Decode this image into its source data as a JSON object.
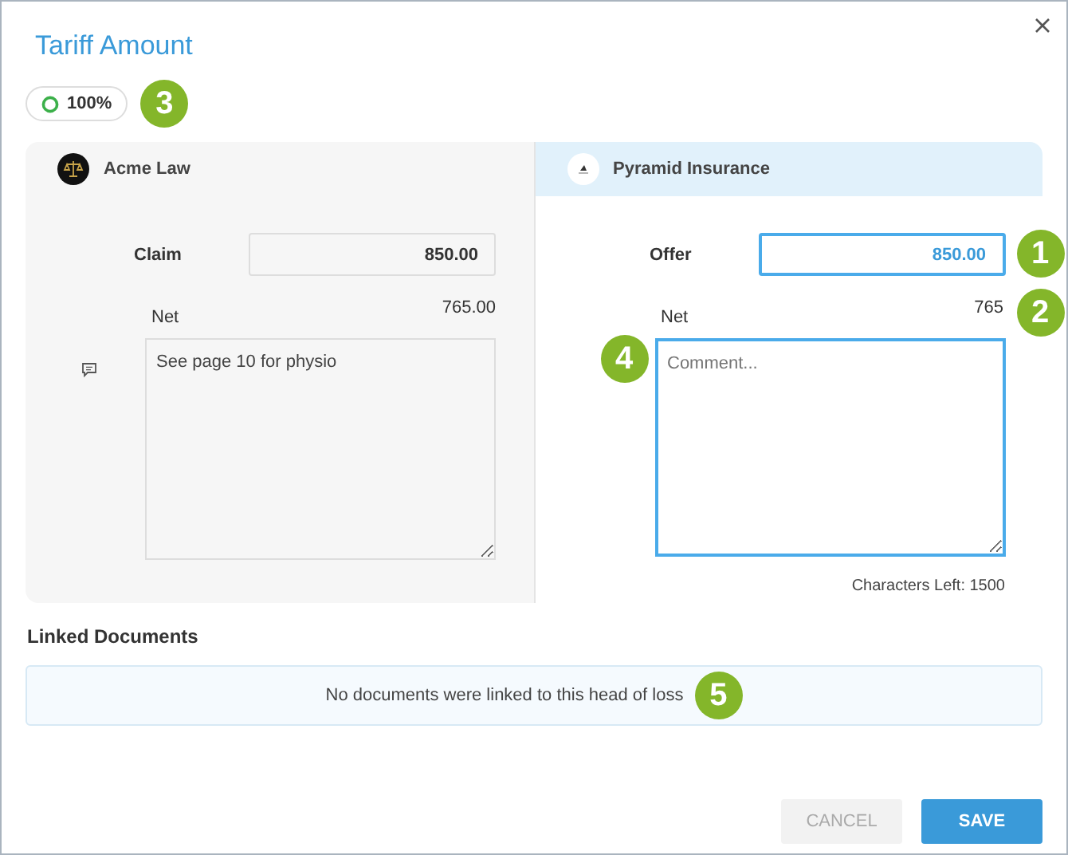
{
  "dialog": {
    "title": "Tariff Amount"
  },
  "progress_badge": {
    "label": "100%",
    "callout": "3"
  },
  "parties": [
    {
      "kind": "claimant",
      "selected": false,
      "name": "Acme Law",
      "amount_label": "Claim",
      "amount": "850.00",
      "net_label": "Net",
      "net": "765.00",
      "comment": "See page 10 for physio"
    },
    {
      "kind": "insurer",
      "selected": true,
      "name": "Pyramid Insurance",
      "amount_label": "Offer",
      "amount": "850.00",
      "amount_callout": "1",
      "net_label": "Net",
      "net": "765",
      "net_callout": "2",
      "comment_placeholder": "Comment...",
      "comment_callout": "4",
      "characters_left": "Characters Left: 1500"
    }
  ],
  "linked_documents": {
    "title": "Linked Documents",
    "empty_message": "No documents were linked to this head of loss",
    "callout": "5"
  },
  "buttons": [
    {
      "label": "CANCEL",
      "disabled": true
    },
    {
      "label": "SAVE",
      "disabled": false
    }
  ]
}
